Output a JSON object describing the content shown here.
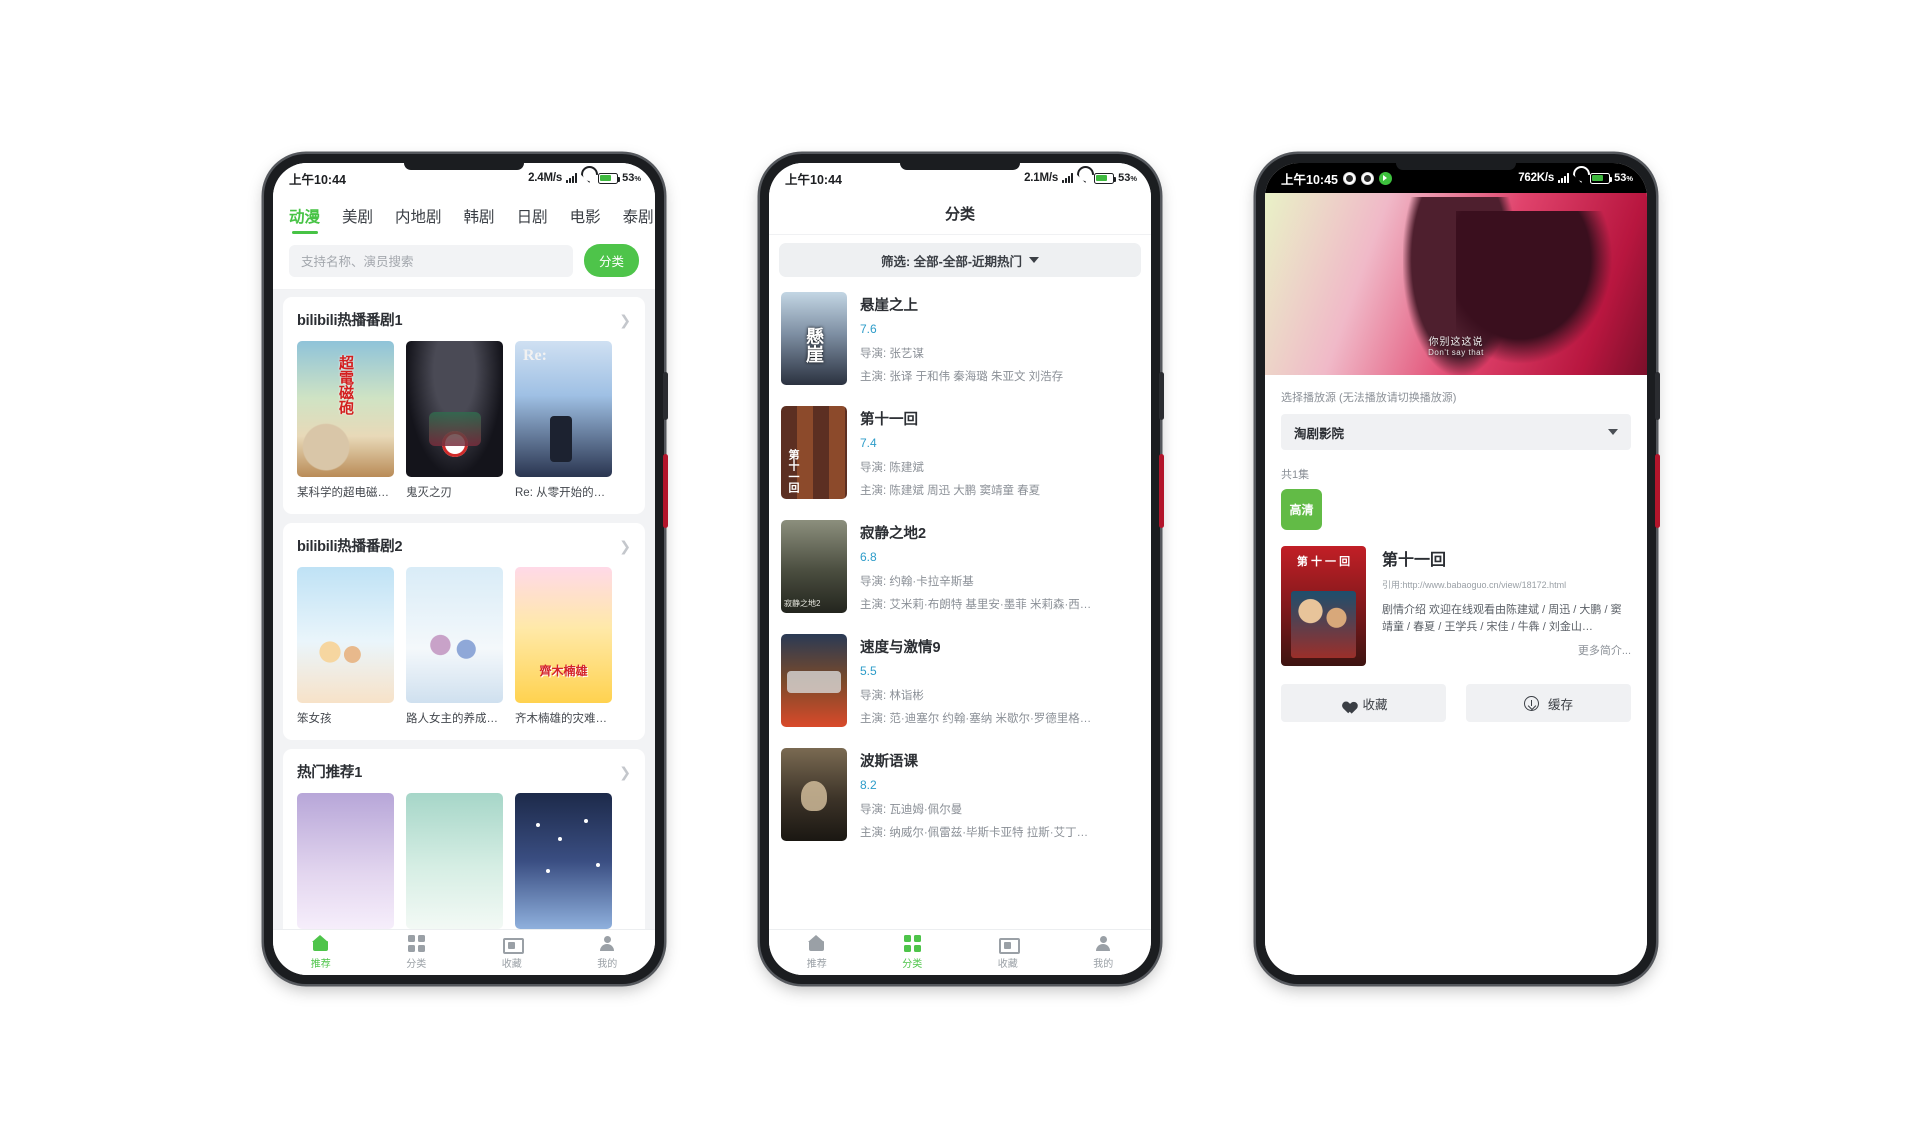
{
  "phone1": {
    "status": {
      "time": "上午10:44",
      "speed": "2.4M/s",
      "battery": "53",
      "pct_symbol": "%"
    },
    "tabs": [
      {
        "label": "动漫",
        "active": true
      },
      {
        "label": "美剧",
        "active": false
      },
      {
        "label": "内地剧",
        "active": false
      },
      {
        "label": "韩剧",
        "active": false
      },
      {
        "label": "日剧",
        "active": false
      },
      {
        "label": "电影",
        "active": false
      },
      {
        "label": "泰剧",
        "active": false
      }
    ],
    "search": {
      "placeholder": "支持名称、演员搜索",
      "button": "分类"
    },
    "sections": [
      {
        "title": "bilibili热播番剧1",
        "items": [
          {
            "name": "某科学的超电磁…"
          },
          {
            "name": "鬼灭之刃"
          },
          {
            "name": "Re: 从零开始的…"
          }
        ]
      },
      {
        "title": "bilibili热播番剧2",
        "items": [
          {
            "name": "笨女孩"
          },
          {
            "name": "路人女主的养成…"
          },
          {
            "name": "齐木楠雄的灾难…"
          }
        ]
      },
      {
        "title": "热门推荐1",
        "items": [
          {
            "name": ""
          },
          {
            "name": ""
          },
          {
            "name": ""
          }
        ]
      }
    ],
    "bottom_nav": [
      {
        "label": "推荐",
        "icon": "home-icon",
        "active": true
      },
      {
        "label": "分类",
        "icon": "grid-icon",
        "active": false
      },
      {
        "label": "收藏",
        "icon": "folder-icon",
        "active": false
      },
      {
        "label": "我的",
        "icon": "person-icon",
        "active": false
      }
    ]
  },
  "phone2": {
    "status": {
      "time": "上午10:44",
      "speed": "2.1M/s",
      "battery": "53",
      "pct_symbol": "%"
    },
    "title": "分类",
    "filter": "筛选: 全部-全部-近期热门",
    "list": [
      {
        "title": "悬崖之上",
        "score": "7.6",
        "director": "导演: 张艺谋",
        "cast": "主演: 张译 于和伟 秦海璐 朱亚文 刘浩存"
      },
      {
        "title": "第十一回",
        "score": "7.4",
        "director": "导演: 陈建斌",
        "cast": "主演: 陈建斌 周迅 大鹏 窦靖童 春夏"
      },
      {
        "title": "寂静之地2",
        "score": "6.8",
        "director": "导演: 约翰·卡拉辛斯基",
        "cast": "主演: 艾米莉·布朗特 基里安·墨菲 米莉森·西…"
      },
      {
        "title": "速度与激情9",
        "score": "5.5",
        "director": "导演: 林诣彬",
        "cast": "主演: 范·迪塞尔 约翰·塞纳 米歇尔·罗德里格…"
      },
      {
        "title": "波斯语课",
        "score": "8.2",
        "director": "导演: 瓦迪姆·佩尔曼",
        "cast": "主演: 纳威尔·佩雷兹·毕斯卡亚特 拉斯·艾丁…"
      }
    ],
    "bottom_nav": [
      {
        "label": "推荐",
        "icon": "home-icon",
        "active": false
      },
      {
        "label": "分类",
        "icon": "grid-icon",
        "active": true
      },
      {
        "label": "收藏",
        "icon": "folder-icon",
        "active": false
      },
      {
        "label": "我的",
        "icon": "person-icon",
        "active": false
      }
    ]
  },
  "phone3": {
    "status": {
      "time": "上午10:45",
      "speed": "762K/s",
      "battery": "53",
      "pct_symbol": "%"
    },
    "subtitle_line1": "你别这这说",
    "subtitle_line2": "Don't say that",
    "source_label": "选择播放源 (无法播放请切换播放源)",
    "source_value": "淘剧影院",
    "episode_label": "共1集",
    "episode_button": "高清",
    "show": {
      "title": "第十一回",
      "url": "引用:http://www.babaoguo.cn/view/18172.html",
      "desc": "剧情介绍 欢迎在线观看由陈建斌 / 周迅 / 大鹏 / 窦靖童 / 春夏 / 王学兵 / 宋佳 / 牛犇 / 刘金山…",
      "more": "更多简介..."
    },
    "actions": [
      {
        "label": "收藏",
        "icon": "heart-icon"
      },
      {
        "label": "缓存",
        "icon": "download-icon"
      }
    ]
  },
  "colors": {
    "accent_green": "#4ec44a",
    "score_blue": "#2d9cc9",
    "hd_green": "#62bb46"
  }
}
